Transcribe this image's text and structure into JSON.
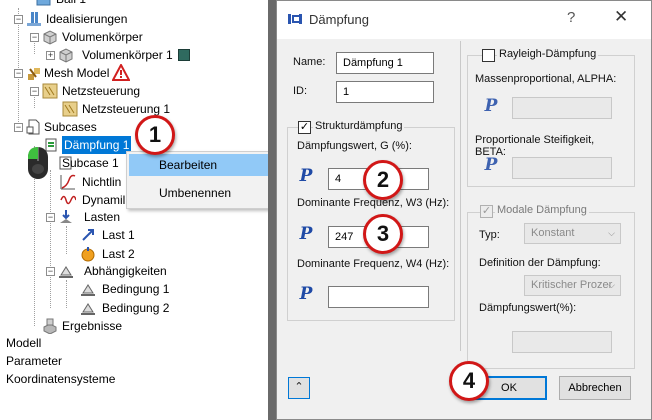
{
  "tree": {
    "items": [
      {
        "label": "Ball 1"
      },
      {
        "label": "Idealisierungen"
      },
      {
        "label": "Volumenkörper"
      },
      {
        "label": "Volumenkörper 1"
      },
      {
        "label": "Mesh Model"
      },
      {
        "label": "Netzsteuerung"
      },
      {
        "label": "Netzsteuerung 1"
      },
      {
        "label": "Subcases"
      },
      {
        "label": "Dämpfung 1"
      },
      {
        "label": "Subcase 1"
      },
      {
        "label": "Nichtlin"
      },
      {
        "label": "Dynamil"
      },
      {
        "label": "Lasten"
      },
      {
        "label": "Last 1"
      },
      {
        "label": "Last 2"
      },
      {
        "label": "Abhängigkeiten"
      },
      {
        "label": "Bedingung 1"
      },
      {
        "label": "Bedingung 2"
      },
      {
        "label": "Ergebnisse"
      },
      {
        "label": "Modell"
      },
      {
        "label": "Parameter"
      },
      {
        "label": "Koordinatensysteme"
      }
    ]
  },
  "context_menu": {
    "items": [
      {
        "label": "Bearbeiten"
      },
      {
        "label": "Umbenennen"
      }
    ]
  },
  "callouts": [
    "1",
    "2",
    "3",
    "4"
  ],
  "dialog": {
    "title": "Dämpfung",
    "help": "?",
    "close": "✕",
    "name_label": "Name:",
    "name_value": "Dämpfung 1",
    "id_label": "ID:",
    "id_value": "1",
    "struct_label": "Strukturdämpfung",
    "g_label": "Dämpfungswert, G (%):",
    "g_value": "4",
    "w3_label": "Dominante Frequenz, W3 (Hz):",
    "w3_value": "247",
    "w4_label": "Dominante Frequenz, W4 (Hz):",
    "w4_value": "",
    "rayleigh_label": "Rayleigh-Dämpfung",
    "alpha_label": "Massenproportional, ALPHA:",
    "beta_label_1": "Proportionale Steifigkeit,",
    "beta_label_2": "BETA:",
    "modal_label": "Modale Dämpfung",
    "typ_label": "Typ:",
    "typ_value": "Konstant",
    "def_label": "Definition der Dämpfung:",
    "def_value": "Kritischer Prozer",
    "modal_value_label": "Dämpfungswert(%):",
    "p_symbol": "P",
    "ok": "OK",
    "cancel": "Abbrechen"
  }
}
